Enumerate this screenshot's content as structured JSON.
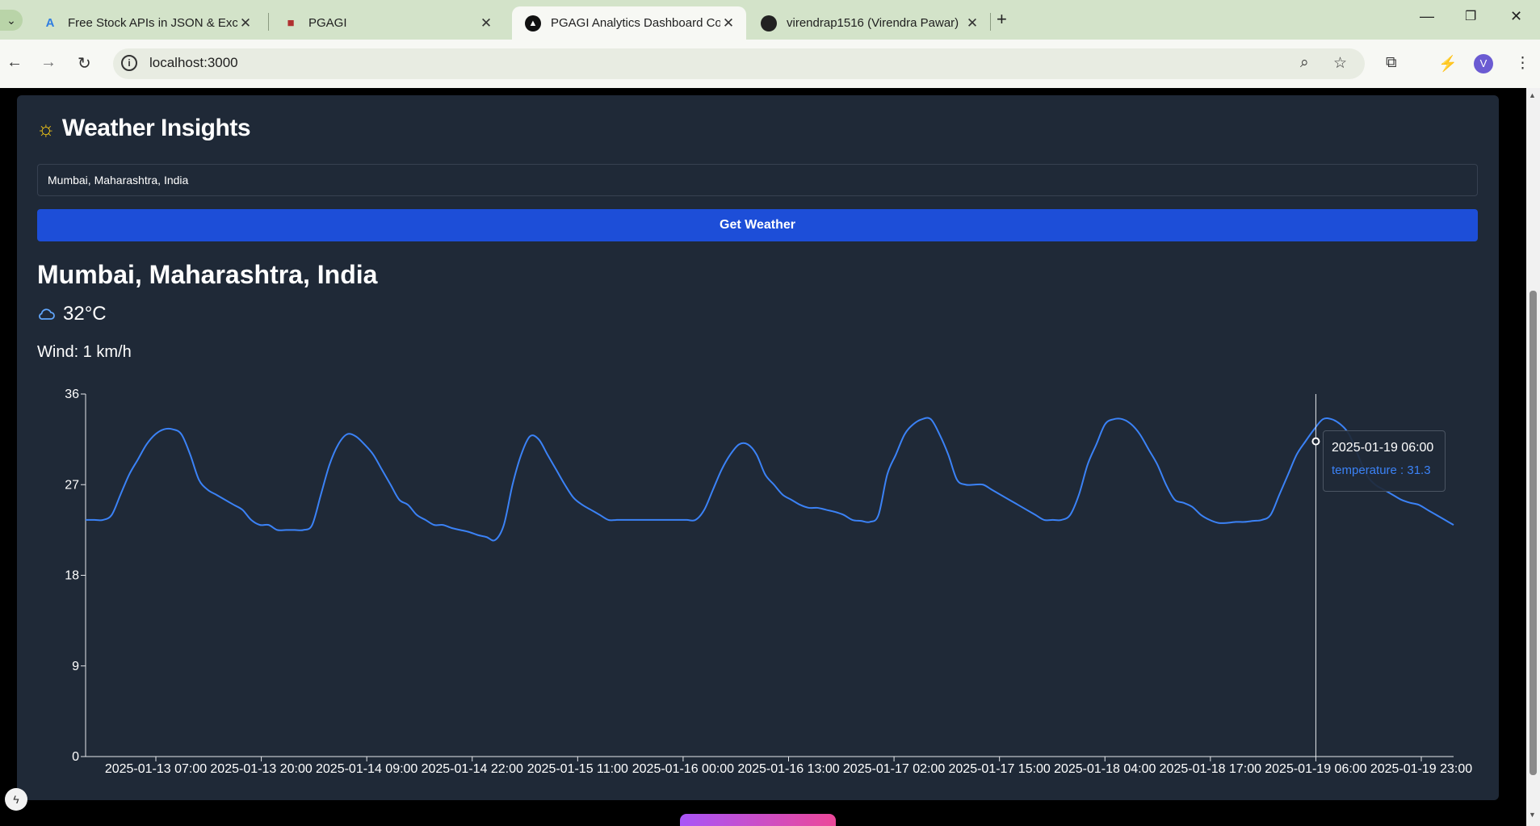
{
  "browser": {
    "tabs": [
      {
        "title": "Free Stock APIs in JSON & Exce",
        "icon": "alpha-icon"
      },
      {
        "title": "PGAGI",
        "icon": "app-icon"
      },
      {
        "title": "PGAGI Analytics Dashboard Co",
        "icon": "triangle-icon"
      },
      {
        "title": "virendrap1516 (Virendra Pawar)",
        "icon": "github-icon"
      }
    ],
    "url": "localhost:3000",
    "profile_initial": "V"
  },
  "weather": {
    "title": "Weather Insights",
    "input_value": "Mumbai, Maharashtra, India",
    "button_label": "Get Weather",
    "city": "Mumbai, Maharashtra, India",
    "temperature": "32°C",
    "wind": "Wind: 1 km/h"
  },
  "tooltip": {
    "label": "2025-01-19 06:00",
    "value": "temperature : 31.3"
  },
  "chart_data": {
    "type": "line",
    "series": [
      {
        "name": "temperature",
        "color": "#3b82f6"
      }
    ],
    "ylim": [
      0,
      36
    ],
    "yticks": [
      0,
      9,
      18,
      27,
      36
    ],
    "xticks": [
      "2025-01-13 07:00",
      "2025-01-13 20:00",
      "2025-01-14 09:00",
      "2025-01-14 22:00",
      "2025-01-15 11:00",
      "2025-01-16 00:00",
      "2025-01-16 13:00",
      "2025-01-17 02:00",
      "2025-01-17 15:00",
      "2025-01-18 04:00",
      "2025-01-18 17:00",
      "2025-01-19 06:00",
      "2025-01-19 23:00"
    ],
    "values": [
      23.5,
      23.5,
      23.5,
      24,
      26,
      28,
      29.5,
      31,
      32,
      32.5,
      32.5,
      32,
      30,
      27.5,
      26.5,
      26,
      25.5,
      25,
      24.5,
      23.5,
      23,
      23,
      22.5,
      22.5,
      22.5,
      22.5,
      23,
      26,
      29,
      31,
      32,
      31.8,
      31,
      30,
      28.5,
      27,
      25.5,
      25,
      24,
      23.5,
      23,
      23,
      22.7,
      22.5,
      22.3,
      22,
      21.8,
      21.5,
      23,
      27,
      30,
      31.8,
      31.5,
      30,
      28.5,
      27,
      25.7,
      25,
      24.5,
      24,
      23.5,
      23.5,
      23.5,
      23.5,
      23.5,
      23.5,
      23.5,
      23.5,
      23.5,
      23.5,
      23.5,
      24.5,
      26.5,
      28.5,
      30,
      31,
      31,
      30,
      28,
      27,
      26,
      25.5,
      25,
      24.7,
      24.7,
      24.5,
      24.3,
      24,
      23.5,
      23.4,
      23.3,
      24,
      28,
      30,
      32,
      33,
      33.5,
      33.5,
      32,
      30,
      27.5,
      27,
      27,
      27,
      26.5,
      26,
      25.5,
      25,
      24.5,
      24,
      23.5,
      23.5,
      23.5,
      24,
      26,
      29,
      31,
      33,
      33.5,
      33.5,
      33,
      32,
      30.5,
      29,
      27,
      25.5,
      25.2,
      24.8,
      24,
      23.5,
      23.2,
      23.2,
      23.3,
      23.3,
      23.4,
      23.5,
      24,
      26,
      28,
      30,
      31.3,
      32.5,
      33.5,
      33.5,
      33,
      32,
      30,
      28,
      27,
      26.5,
      26,
      25.5,
      25.2,
      25,
      24.5,
      24,
      23.5,
      23
    ]
  }
}
